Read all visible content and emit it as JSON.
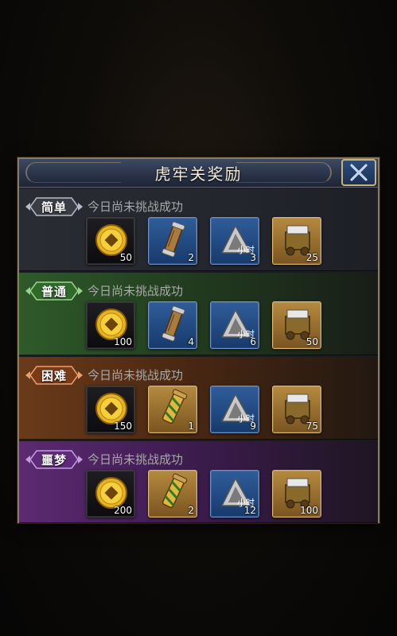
{
  "dialog": {
    "title": "虎牢关奖励",
    "close_icon": "close-x-icon"
  },
  "tiers": [
    {
      "label": "简单",
      "status": "今日尚未挑战成功",
      "color": "#2a2c34",
      "items": [
        {
          "icon": "gold-coin-icon",
          "quantity": "50"
        },
        {
          "icon": "scroll-icon",
          "quantity": "2"
        },
        {
          "icon": "time-token-icon",
          "icon_text": "小时",
          "quantity": "3"
        },
        {
          "icon": "treasure-cart-icon",
          "quantity": "25"
        }
      ]
    },
    {
      "label": "普通",
      "status": "今日尚未挑战成功",
      "color": "#2f5a2a",
      "items": [
        {
          "icon": "gold-coin-icon",
          "quantity": "100"
        },
        {
          "icon": "scroll-icon",
          "quantity": "4"
        },
        {
          "icon": "time-token-icon",
          "icon_text": "小时",
          "quantity": "6"
        },
        {
          "icon": "treasure-cart-icon",
          "quantity": "50"
        }
      ]
    },
    {
      "label": "困难",
      "status": "今日尚未挑战成功",
      "color": "#6a3a1a",
      "items": [
        {
          "icon": "gold-coin-icon",
          "quantity": "150"
        },
        {
          "icon": "golden-scroll-icon",
          "quantity": "1"
        },
        {
          "icon": "time-token-icon",
          "icon_text": "小时",
          "quantity": "9"
        },
        {
          "icon": "treasure-cart-icon",
          "quantity": "75"
        }
      ]
    },
    {
      "label": "噩梦",
      "status": "今日尚未挑战成功",
      "color": "#5c2a72",
      "items": [
        {
          "icon": "gold-coin-icon",
          "quantity": "200"
        },
        {
          "icon": "golden-scroll-icon",
          "quantity": "2"
        },
        {
          "icon": "time-token-icon",
          "icon_text": "小时",
          "quantity": "12"
        },
        {
          "icon": "treasure-cart-icon",
          "quantity": "100"
        }
      ]
    }
  ]
}
